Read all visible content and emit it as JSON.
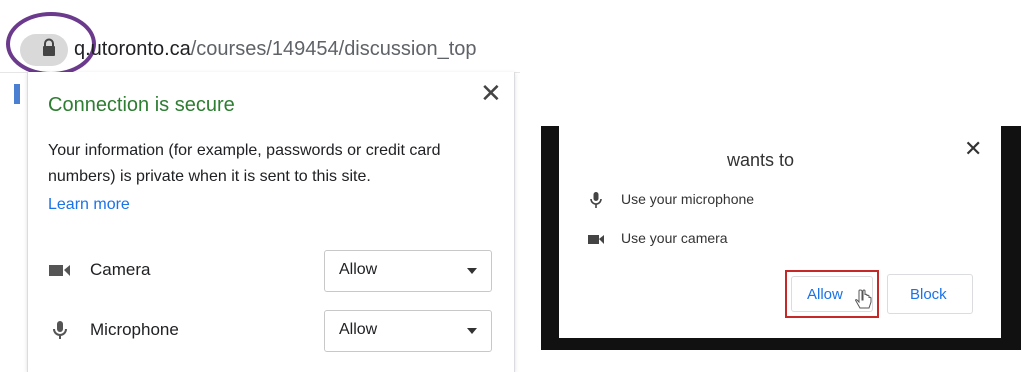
{
  "address_bar": {
    "url_host": "q.utoronto.ca",
    "url_path": "/courses/149454/discussion_top"
  },
  "site_info_popup": {
    "title": "Connection is secure",
    "description": "Your information (for example, passwords or credit card numbers) is private when it is sent to this site.",
    "learn_more": "Learn more",
    "close_glyph": "✕",
    "permissions": [
      {
        "label": "Camera",
        "value": "Allow",
        "icon": "camera-icon"
      },
      {
        "label": "Microphone",
        "value": "Allow",
        "icon": "microphone-icon"
      }
    ]
  },
  "permission_prompt": {
    "title": "wants to",
    "close_glyph": "✕",
    "requests": [
      {
        "label": "Use your microphone",
        "icon": "microphone-icon"
      },
      {
        "label": "Use your camera",
        "icon": "camera-icon"
      }
    ],
    "allow_label": "Allow",
    "block_label": "Block"
  },
  "colors": {
    "secure_green": "#2e7d32",
    "link_blue": "#1a73e8",
    "highlight_purple": "#6b3a8c",
    "highlight_red": "#c62828"
  }
}
